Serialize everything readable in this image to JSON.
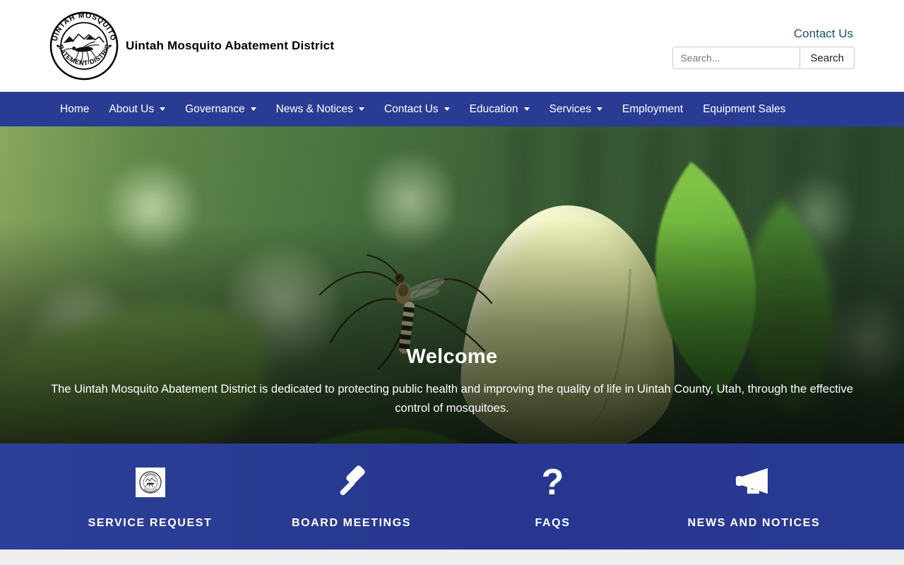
{
  "header": {
    "site_title": "Uintah Mosquito Abatement District",
    "logo": {
      "top_text": "UINTAH MOSQUITO",
      "bottom_text": "ABATEMENT DISTRICT"
    },
    "contact_link": "Contact Us",
    "search": {
      "placeholder": "Search...",
      "button_label": "Search"
    }
  },
  "nav": {
    "items": [
      {
        "label": "Home",
        "has_dropdown": false
      },
      {
        "label": "About Us",
        "has_dropdown": true
      },
      {
        "label": "Governance",
        "has_dropdown": true
      },
      {
        "label": "News & Notices",
        "has_dropdown": true
      },
      {
        "label": "Contact Us",
        "has_dropdown": true
      },
      {
        "label": "Education",
        "has_dropdown": true
      },
      {
        "label": "Services",
        "has_dropdown": true
      },
      {
        "label": "Employment",
        "has_dropdown": false
      },
      {
        "label": "Equipment Sales",
        "has_dropdown": false
      }
    ]
  },
  "hero": {
    "title": "Welcome",
    "description": "The Uintah Mosquito Abatement District is dedicated to protecting public health and improving the quality of life in Uintah County, Utah, through the effective control of mosquitoes."
  },
  "quick_links": {
    "items": [
      {
        "label": "SERVICE REQUEST",
        "icon": "district-seal"
      },
      {
        "label": "BOARD MEETINGS",
        "icon": "gavel"
      },
      {
        "label": "FAQS",
        "icon": "question-mark",
        "glyph": "?"
      },
      {
        "label": "NEWS AND NOTICES",
        "icon": "megaphone"
      }
    ]
  },
  "colors": {
    "nav_blue": "#2a3b94",
    "quick_links_blue": "#283a92",
    "contact_link_blue": "#1c4e79",
    "footer_gray": "#efefef"
  }
}
